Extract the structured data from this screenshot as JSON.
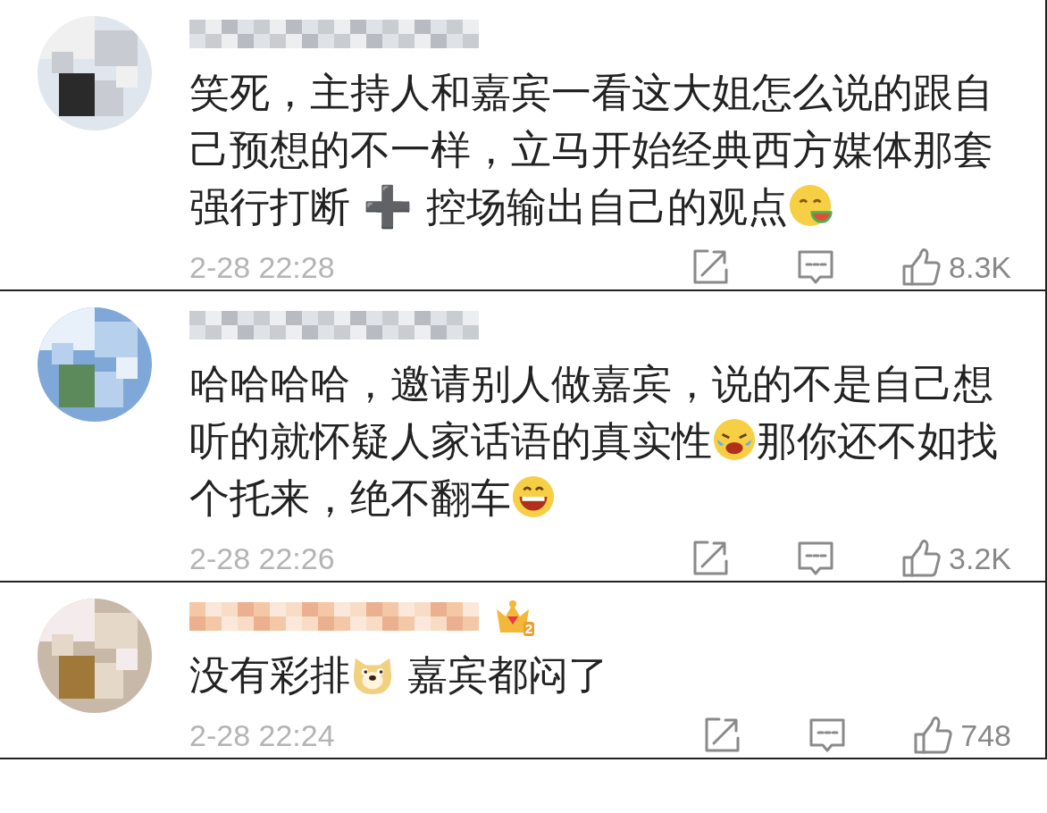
{
  "comments": [
    {
      "segments": [
        {
          "kind": "text",
          "text": "笑死，主持人和嘉宾一看这大姐怎么说的跟自己预想的不一样，立马开始经典西方媒体那套强行打断 ➕ 控场输出自己的观点"
        },
        {
          "kind": "watermelon"
        }
      ],
      "time": "2-28 22:28",
      "likes": "8.3K"
    },
    {
      "segments": [
        {
          "kind": "text",
          "text": "哈哈哈哈，邀请别人做嘉宾，说的不是自己想听的就怀疑人家话语的真实性"
        },
        {
          "kind": "crying"
        },
        {
          "kind": "text",
          "text": "那你还不如找个托来，绝不翻车"
        },
        {
          "kind": "grin"
        }
      ],
      "time": "2-28 22:26",
      "likes": "3.2K"
    },
    {
      "badge_level": "2",
      "segments": [
        {
          "kind": "text",
          "text": "没有彩排"
        },
        {
          "kind": "doge"
        },
        {
          "kind": "text",
          "text": " 嘉宾都闷了"
        }
      ],
      "time": "2-28 22:24",
      "likes": "748"
    }
  ]
}
